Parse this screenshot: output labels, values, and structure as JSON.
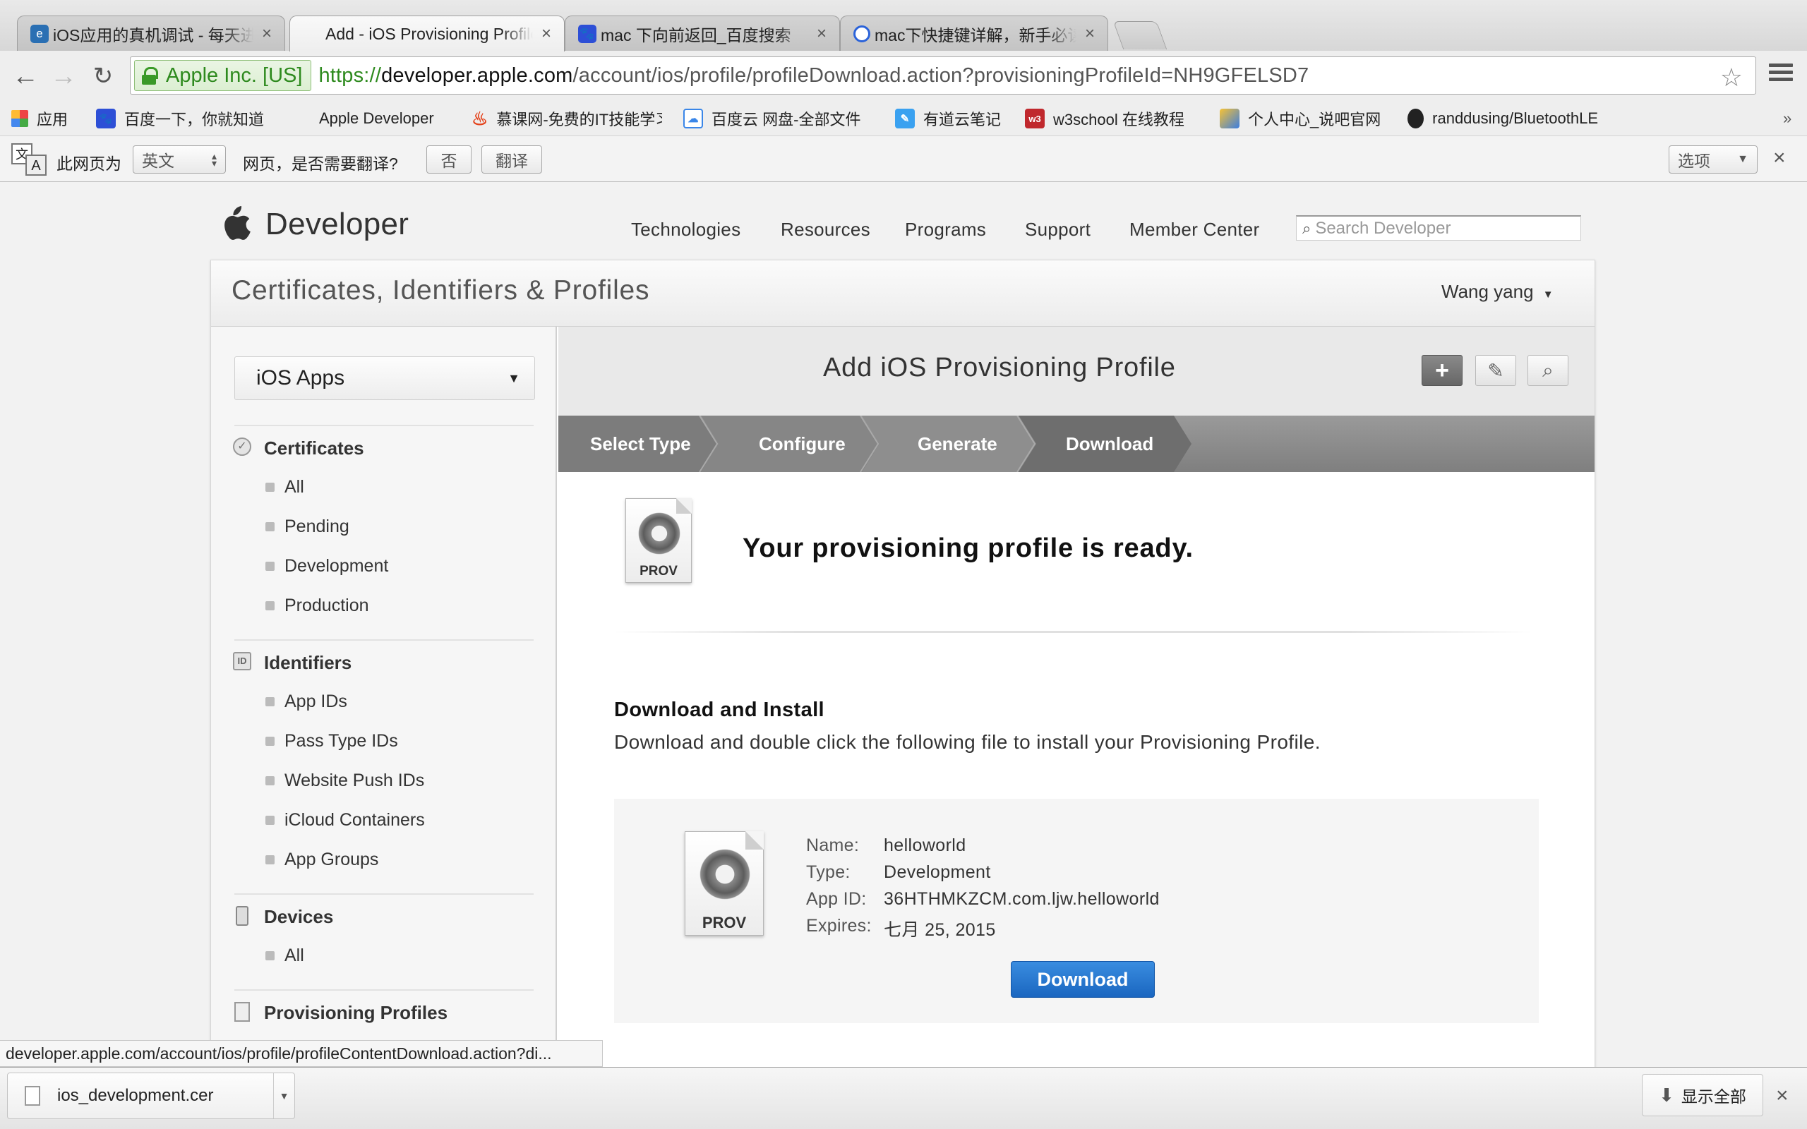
{
  "browser": {
    "tabs": [
      {
        "title": "iOS应用的真机调试 - 每天进步"
      },
      {
        "title": "Add - iOS Provisioning Profile"
      },
      {
        "title": "mac 下向前返回_百度搜索"
      },
      {
        "title": "mac下快捷键详解，新手必读"
      }
    ],
    "address": {
      "ev_label": "Apple Inc. [US]",
      "scheme": "https://",
      "domain": "developer.apple.com",
      "path": "/account/ios/profile/profileDownload.action?provisioningProfileId=NH9GFELSD7"
    },
    "bookmarks": [
      {
        "label": "应用",
        "icon": "apps-grid-icon"
      },
      {
        "label": "百度一下，你就知道",
        "icon": "baidu-paw-icon"
      },
      {
        "label": "Apple Developer",
        "icon": "apple-icon"
      },
      {
        "label": "慕课网-免费的IT技能学习平台",
        "icon": "flame-icon"
      },
      {
        "label": "百度云 网盘-全部文件",
        "icon": "cloud-icon"
      },
      {
        "label": "有道云笔记",
        "icon": "note-icon"
      },
      {
        "label": "w3school 在线教程",
        "icon": "w3-icon"
      },
      {
        "label": "个人中心_说吧官网",
        "icon": "puzzle-icon"
      },
      {
        "label": "randdusing/BluetoothLE",
        "icon": "github-icon"
      }
    ],
    "translate_bar": {
      "prefix": "此网页为",
      "language": "英文",
      "question": "网页，是否需要翻译?",
      "no_button": "否",
      "translate_button": "翻译",
      "options_button": "选项"
    },
    "status_url": "developer.apple.com/account/ios/profile/profileContentDownload.action?di...",
    "downloads": {
      "file": "ios_development.cer",
      "show_all": "显示全部"
    }
  },
  "site": {
    "brand": "Developer",
    "nav": [
      "Technologies",
      "Resources",
      "Programs",
      "Support",
      "Member Center"
    ],
    "search_placeholder": "Search Developer"
  },
  "portal": {
    "title": "Certificates, Identifiers & Profiles",
    "user": "Wang yang",
    "platform_select": "iOS Apps",
    "sidebar": {
      "certificates": {
        "label": "Certificates",
        "items": [
          "All",
          "Pending",
          "Development",
          "Production"
        ]
      },
      "identifiers": {
        "label": "Identifiers",
        "items": [
          "App IDs",
          "Pass Type IDs",
          "Website Push IDs",
          "iCloud Containers",
          "App Groups"
        ]
      },
      "devices": {
        "label": "Devices",
        "items": [
          "All"
        ]
      },
      "profiles": {
        "label": "Provisioning Profiles"
      }
    },
    "panel_title": "Add iOS Provisioning Profile",
    "steps": [
      "Select Type",
      "Configure",
      "Generate",
      "Download"
    ],
    "ready_message": "Your provisioning profile is ready.",
    "prov_icon_label": "PROV",
    "download_section": {
      "heading": "Download and Install",
      "description": "Download and double click the following file to install your Provisioning Profile.",
      "fields": [
        {
          "label": "Name:",
          "value": "helloworld"
        },
        {
          "label": "Type:",
          "value": "Development"
        },
        {
          "label": "App ID:",
          "value": "36HTHMKZCM.com.ljw.helloworld"
        },
        {
          "label": "Expires:",
          "value": "七月 25, 2015"
        }
      ],
      "button": "Download"
    }
  },
  "colors": {
    "accent_blue": "#1a66c0",
    "ev_green": "#2e8a1e",
    "steps_gray": "#8a8a8a"
  }
}
